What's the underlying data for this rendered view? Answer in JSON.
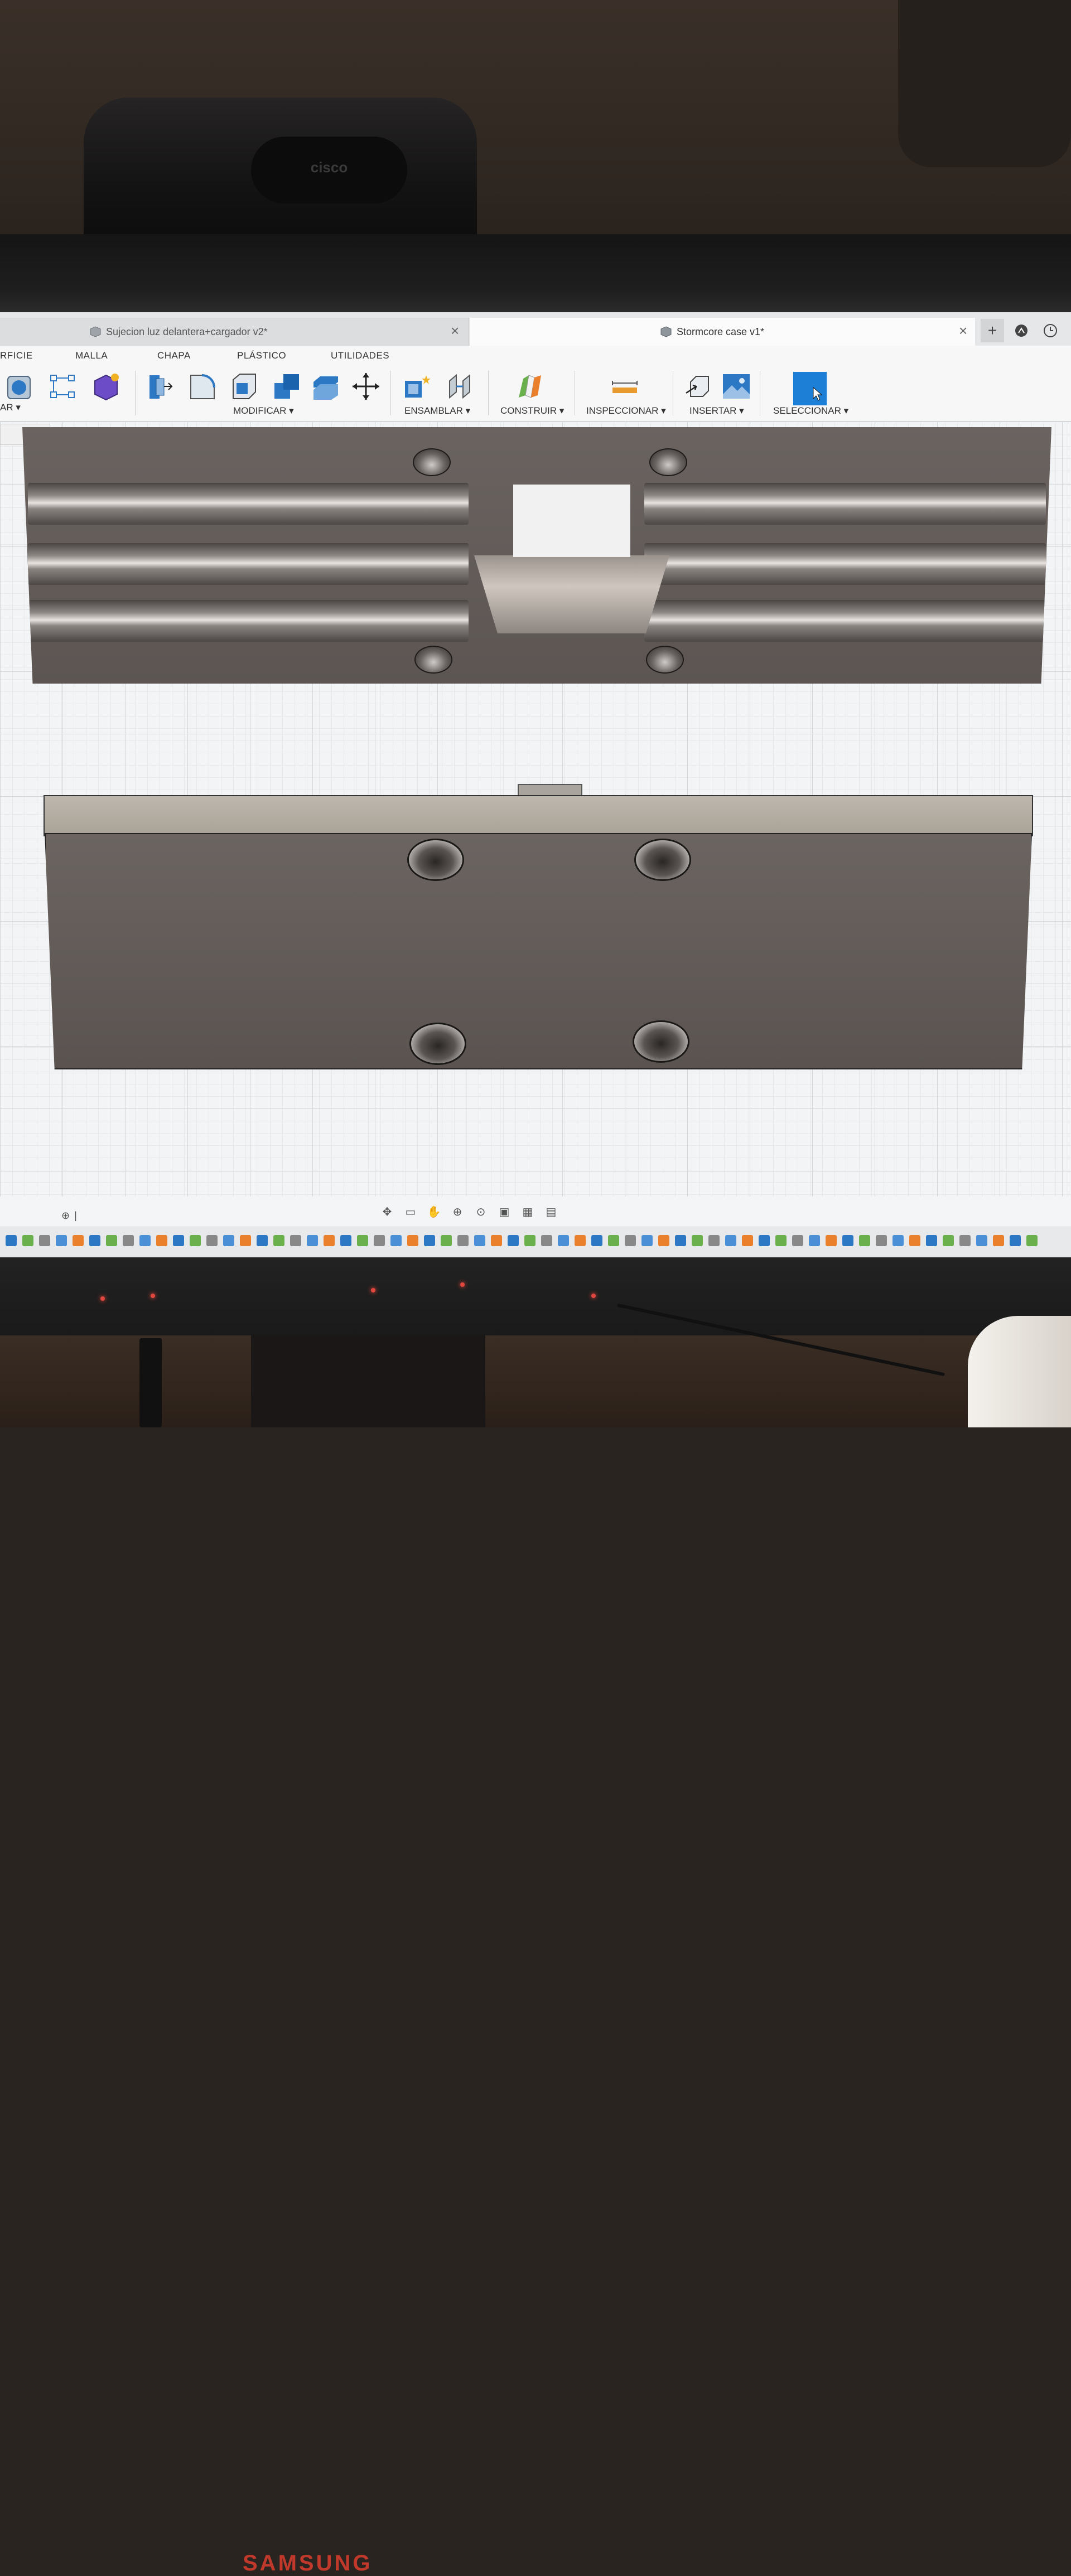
{
  "device": {
    "webcam_logo": "cisco",
    "monitor_brand": "SAMSUNG"
  },
  "tabs": [
    {
      "label": "Sujecion luz delantera+cargador v2*",
      "active": false
    },
    {
      "label": "Stormcore case v1*",
      "active": true
    }
  ],
  "categories": [
    "RFICIE",
    "MALLA",
    "CHAPA",
    "PLÁSTICO",
    "UTILIDADES"
  ],
  "toolbar": {
    "partial_label": "AR ▾",
    "groups": [
      "MODIFICAR ▾",
      "ENSAMBLAR ▾",
      "CONSTRUIR ▾",
      "INSPECCIONAR ▾",
      "INSERTAR ▾",
      "SELECCIONAR ▾"
    ]
  },
  "colors": {
    "accent": "#1e7fd6",
    "grid": "#d4d8dc",
    "model_dark": "#5c5552",
    "model_light": "#bdb7ad"
  },
  "icons": {
    "tab_add": "plus-icon",
    "tab_bar_extra": [
      "account-icon",
      "clock-icon"
    ],
    "navigation": [
      "orbit-icon",
      "look-at-icon",
      "pan-icon",
      "zoom-window-icon",
      "zoom-fit-icon",
      "display-settings-icon",
      "grid-icon",
      "viewports-icon"
    ]
  }
}
